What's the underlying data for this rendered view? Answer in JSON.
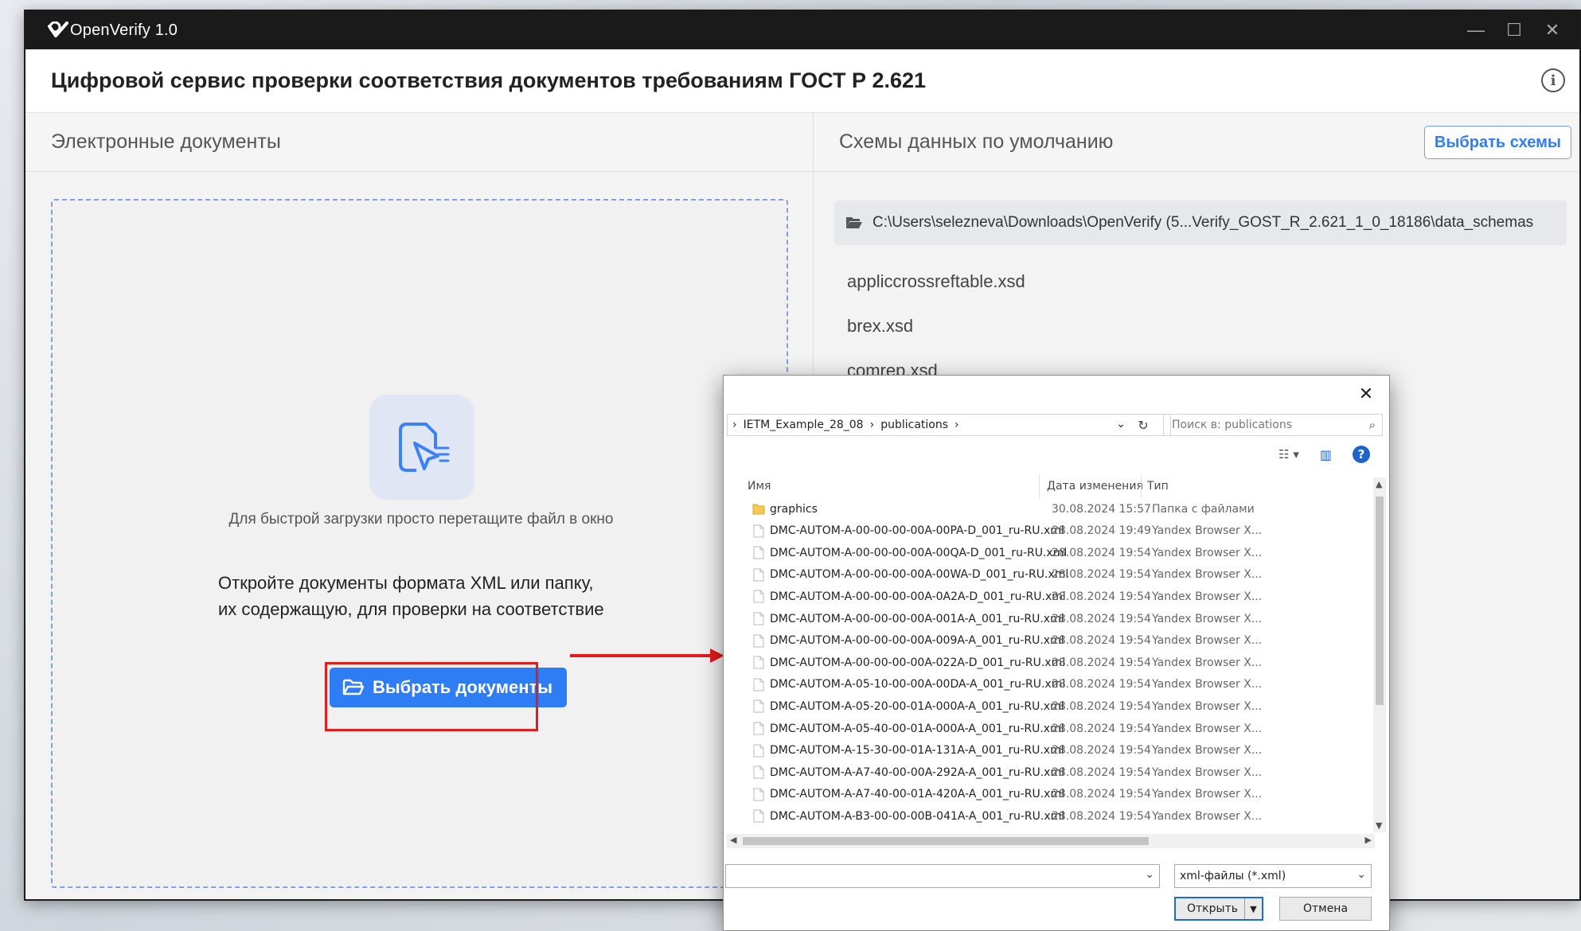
{
  "window": {
    "app_name": "OpenVerify 1.0",
    "controls": {
      "minimize": "—",
      "maximize": "☐",
      "close": "✕"
    }
  },
  "header": {
    "title": "Цифровой сервис проверки соответствия документов требованиям ГОСТ Р 2.621",
    "info_icon": "i"
  },
  "left": {
    "section_title": "Электронные документы",
    "drop_hint": "Для быстрой загрузки просто перетащите файл в окно",
    "instructions_line1": "Откройте документы формата XML или папку,",
    "instructions_line2": "их содержащую, для проверки на соответствие",
    "choose_docs_label": "Выбрать документы"
  },
  "right": {
    "section_title": "Схемы данных по умолчанию",
    "choose_schemas_label": "Выбрать схемы",
    "schema_path": "C:\\Users\\selezneva\\Downloads\\OpenVerify (5...Verify_GOST_R_2.621_1_0_18186\\data_schemas",
    "schemas": [
      "appliccrossreftable.xsd",
      "brex.xsd",
      "comrep.xsd"
    ]
  },
  "dialog": {
    "breadcrumb": [
      "IETM_Example_28_08",
      "publications"
    ],
    "search_placeholder": "Поиск в: publications",
    "columns": {
      "name": "Имя",
      "date": "Дата изменения",
      "type": "Тип"
    },
    "rows": [
      {
        "name": "graphics",
        "date": "30.08.2024 15:57",
        "type": "Папка с файлами",
        "kind": "folder"
      },
      {
        "name": "DMC-AUTOM-A-00-00-00-00A-00PA-D_001_ru-RU.xml",
        "date": "28.08.2024 19:49",
        "type": "Yandex Browser X...",
        "kind": "file"
      },
      {
        "name": "DMC-AUTOM-A-00-00-00-00A-00QA-D_001_ru-RU.xml",
        "date": "28.08.2024 19:54",
        "type": "Yandex Browser X...",
        "kind": "file"
      },
      {
        "name": "DMC-AUTOM-A-00-00-00-00A-00WA-D_001_ru-RU.xml",
        "date": "28.08.2024 19:54",
        "type": "Yandex Browser X...",
        "kind": "file"
      },
      {
        "name": "DMC-AUTOM-A-00-00-00-00A-0A2A-D_001_ru-RU.xml",
        "date": "28.08.2024 19:54",
        "type": "Yandex Browser X...",
        "kind": "file"
      },
      {
        "name": "DMC-AUTOM-A-00-00-00-00A-001A-A_001_ru-RU.xml",
        "date": "28.08.2024 19:54",
        "type": "Yandex Browser X...",
        "kind": "file"
      },
      {
        "name": "DMC-AUTOM-A-00-00-00-00A-009A-A_001_ru-RU.xml",
        "date": "28.08.2024 19:54",
        "type": "Yandex Browser X...",
        "kind": "file"
      },
      {
        "name": "DMC-AUTOM-A-00-00-00-00A-022A-D_001_ru-RU.xml",
        "date": "28.08.2024 19:54",
        "type": "Yandex Browser X...",
        "kind": "file"
      },
      {
        "name": "DMC-AUTOM-A-05-10-00-00A-00DA-A_001_ru-RU.xml",
        "date": "28.08.2024 19:54",
        "type": "Yandex Browser X...",
        "kind": "file"
      },
      {
        "name": "DMC-AUTOM-A-05-20-00-01A-000A-A_001_ru-RU.xml",
        "date": "28.08.2024 19:54",
        "type": "Yandex Browser X...",
        "kind": "file"
      },
      {
        "name": "DMC-AUTOM-A-05-40-00-01A-000A-A_001_ru-RU.xml",
        "date": "28.08.2024 19:54",
        "type": "Yandex Browser X...",
        "kind": "file"
      },
      {
        "name": "DMC-AUTOM-A-15-30-00-01A-131A-A_001_ru-RU.xml",
        "date": "28.08.2024 19:54",
        "type": "Yandex Browser X...",
        "kind": "file"
      },
      {
        "name": "DMC-AUTOM-A-A7-40-00-00A-292A-A_001_ru-RU.xml",
        "date": "28.08.2024 19:54",
        "type": "Yandex Browser X...",
        "kind": "file"
      },
      {
        "name": "DMC-AUTOM-A-A7-40-00-01A-420A-A_001_ru-RU.xml",
        "date": "28.08.2024 19:54",
        "type": "Yandex Browser X...",
        "kind": "file"
      },
      {
        "name": "DMC-AUTOM-A-B3-00-00-00B-041A-A_001_ru-RU.xml",
        "date": "28.08.2024 19:54",
        "type": "Yandex Browser X...",
        "kind": "file"
      }
    ],
    "filename_value": "",
    "filter_value": "xml-файлы (*.xml)",
    "open_label": "Открыть",
    "cancel_label": "Отмена"
  },
  "colors": {
    "accent": "#2f7df5",
    "highlight": "#e21b1b",
    "titlebar": "#1a1a1a"
  }
}
